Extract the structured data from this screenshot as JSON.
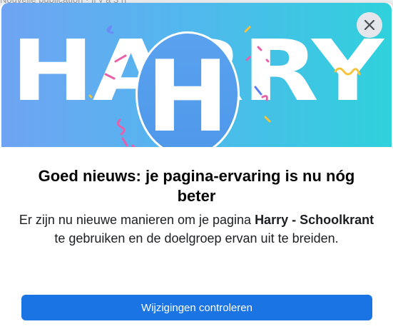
{
  "background": {
    "partial_text": "Nouvelle publication · Il y a 3 h"
  },
  "dialog": {
    "banner": {
      "page_name_graphic": "HARRY",
      "avatar_letter": "H",
      "gradient_start": "#6fa4f3",
      "gradient_end": "#2fd1dc"
    },
    "close_icon": "close-icon",
    "title": "Goed nieuws: je pagina-ervaring is nu nóg beter",
    "body": {
      "before": "Er zijn nu nieuwe manieren om je pagina ",
      "page_name": "Harry - Schoolkrant",
      "after": " te gebruiken en de doelgroep ervan uit te breiden."
    },
    "primary_button_label": "Wijzigingen controleren",
    "accent_color": "#1b74e4"
  }
}
